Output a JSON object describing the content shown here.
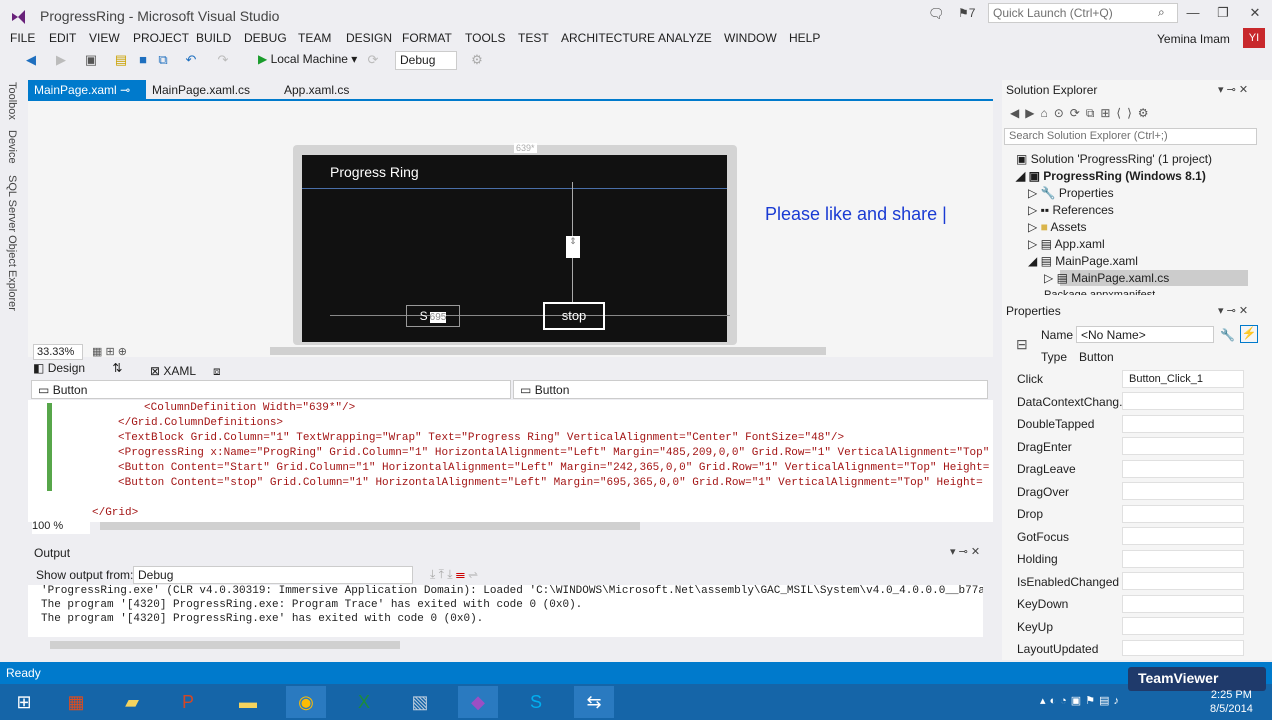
{
  "window": {
    "title": "ProgressRing - Microsoft Visual Studio",
    "notification_count": "7",
    "quick_launch_placeholder": "Quick Launch (Ctrl+Q)"
  },
  "menu": [
    "FILE",
    "EDIT",
    "VIEW",
    "PROJECT",
    "BUILD",
    "DEBUG",
    "TEAM",
    "DESIGN",
    "FORMAT",
    "TOOLS",
    "TEST",
    "ARCHITECTURE",
    "ANALYZE",
    "WINDOW",
    "HELP"
  ],
  "user": {
    "name": "Yemina Imam",
    "initials": "YI"
  },
  "toolbar": {
    "run_target": "Local Machine",
    "config": "Debug"
  },
  "left_rail": [
    "Toolbox",
    "Device",
    "SQL Server Object Explorer"
  ],
  "doc_tabs": [
    "MainPage.xaml",
    "MainPage.xaml.cs",
    "App.xaml.cs"
  ],
  "designer": {
    "app_title": "Progress Ring",
    "start_btn": "S",
    "start_margin": "695",
    "stop_btn": "stop",
    "overlay_text": "Please like and share |",
    "width_marker": "639*",
    "zoom": "33.33%"
  },
  "view_tabs": {
    "design": "Design",
    "xaml": "XAML"
  },
  "element_selectors": {
    "left": "Button",
    "right": "Button"
  },
  "code": {
    "lines": [
      "<ColumnDefinition Width=\"639*\"/>",
      "</Grid.ColumnDefinitions>",
      "<TextBlock Grid.Column=\"1\" TextWrapping=\"Wrap\" Text=\"Progress Ring\" VerticalAlignment=\"Center\" FontSize=\"48\"/>",
      "<ProgressRing x:Name=\"ProgRing\" Grid.Column=\"1\" HorizontalAlignment=\"Left\" Margin=\"485,209,0,0\" Grid.Row=\"1\" VerticalAlignment=\"Top\"",
      "<Button Content=\"Start\" Grid.Column=\"1\" HorizontalAlignment=\"Left\" Margin=\"242,365,0,0\" Grid.Row=\"1\" VerticalAlignment=\"Top\" Height=",
      "<Button Content=\"stop\" Grid.Column=\"1\" HorizontalAlignment=\"Left\" Margin=\"695,365,0,0\" Grid.Row=\"1\" VerticalAlignment=\"Top\" Height=",
      "",
      "</Grid>"
    ],
    "zoom": "100 %"
  },
  "output": {
    "title": "Output",
    "show_label": "Show output from:",
    "source": "Debug",
    "lines": [
      "'ProgressRing.exe' (CLR v4.0.30319: Immersive Application Domain): Loaded 'C:\\WINDOWS\\Microsoft.Net\\assembly\\GAC_MSIL\\System\\v4.0_4.0.0.0__b77a5",
      "The program '[4320] ProgressRing.exe: Program Trace' has exited with code 0 (0x0).",
      "The program '[4320] ProgressRing.exe' has exited with code 0 (0x0)."
    ]
  },
  "solution_explorer": {
    "title": "Solution Explorer",
    "search_placeholder": "Search Solution Explorer (Ctrl+;)",
    "items": [
      "Solution 'ProgressRing' (1 project)",
      "ProgressRing (Windows 8.1)",
      "Properties",
      "References",
      "Assets",
      "App.xaml",
      "MainPage.xaml",
      "MainPage.xaml.cs",
      "Package.appxmanifest"
    ]
  },
  "properties": {
    "title": "Properties",
    "name_label": "Name",
    "name_value": "<No Name>",
    "type_label": "Type",
    "type_value": "Button",
    "events": [
      {
        "name": "Click",
        "value": "Button_Click_1"
      },
      {
        "name": "DataContextChang...",
        "value": ""
      },
      {
        "name": "DoubleTapped",
        "value": ""
      },
      {
        "name": "DragEnter",
        "value": ""
      },
      {
        "name": "DragLeave",
        "value": ""
      },
      {
        "name": "DragOver",
        "value": ""
      },
      {
        "name": "Drop",
        "value": ""
      },
      {
        "name": "GotFocus",
        "value": ""
      },
      {
        "name": "Holding",
        "value": ""
      },
      {
        "name": "IsEnabledChanged",
        "value": ""
      },
      {
        "name": "KeyDown",
        "value": ""
      },
      {
        "name": "KeyUp",
        "value": ""
      },
      {
        "name": "LayoutUpdated",
        "value": ""
      }
    ]
  },
  "status": {
    "text": "Ready"
  },
  "teamviewer": "TeamViewer",
  "clock": {
    "time": "2:25 PM",
    "date": "8/5/2014"
  }
}
